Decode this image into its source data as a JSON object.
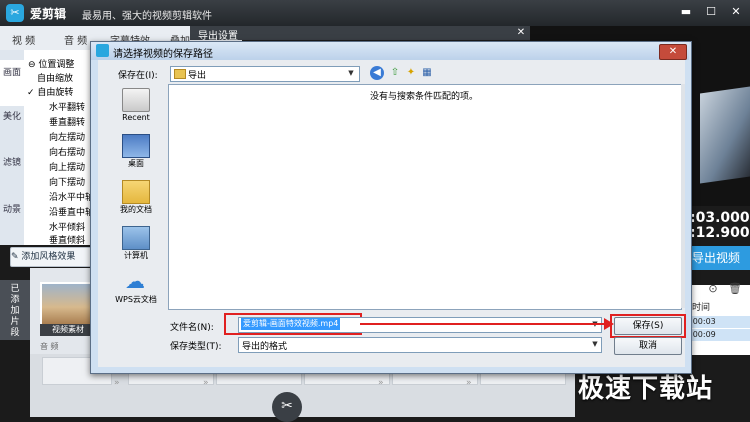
{
  "app": {
    "logo_text": "✂",
    "name": "爱剪辑",
    "slogan": "最易用、强大的视频剪辑软件",
    "tabs": [
      "视 频",
      "音 频",
      "字幕特效",
      "叠加"
    ]
  },
  "sidebar": {
    "items": [
      "画面",
      "美化",
      "滤镜",
      "动景"
    ]
  },
  "effects": {
    "header": "位置调整",
    "items": [
      "自由缩放",
      "自由旋转",
      "水平翻转",
      "垂直翻转",
      "向左摆动",
      "向右摆动",
      "向上摆动",
      "向下摆动",
      "沿水平中轴",
      "沿垂直中轴",
      "水平倾斜",
      "垂直倾斜"
    ]
  },
  "add_style_button": "添加风格效果",
  "added_clips_label": "已添加片段",
  "clip": {
    "label": "视频素材",
    "audio_label": "音 频"
  },
  "export_settings_title": "导出设置",
  "preview": {
    "time_1": ":03.000",
    "time_2": ":12.900",
    "export_button": "导出视频",
    "table_header": "时间",
    "rows": [
      ":00:03",
      ":00:09"
    ]
  },
  "watermark": "极速下载站",
  "dialog": {
    "title": "请选择视频的保存路径",
    "close_symbol": "✕",
    "save_in_label": "保存在(I):",
    "save_in_value": "导出",
    "places": [
      "Recent",
      "桌面",
      "我的文档",
      "计算机",
      "WPS云文档"
    ],
    "empty_message": "没有与搜索条件匹配的项。",
    "filename_label": "文件名(N):",
    "filename_value": "爱剪辑-画面特效视频.mp4",
    "filetype_label": "保存类型(T):",
    "filetype_value": "导出的格式",
    "save_button": "保存(S)",
    "cancel_button": "取消"
  },
  "colors": {
    "accent": "#2d9be0",
    "annotation_red": "#e02020",
    "selection": "#3399ff"
  }
}
